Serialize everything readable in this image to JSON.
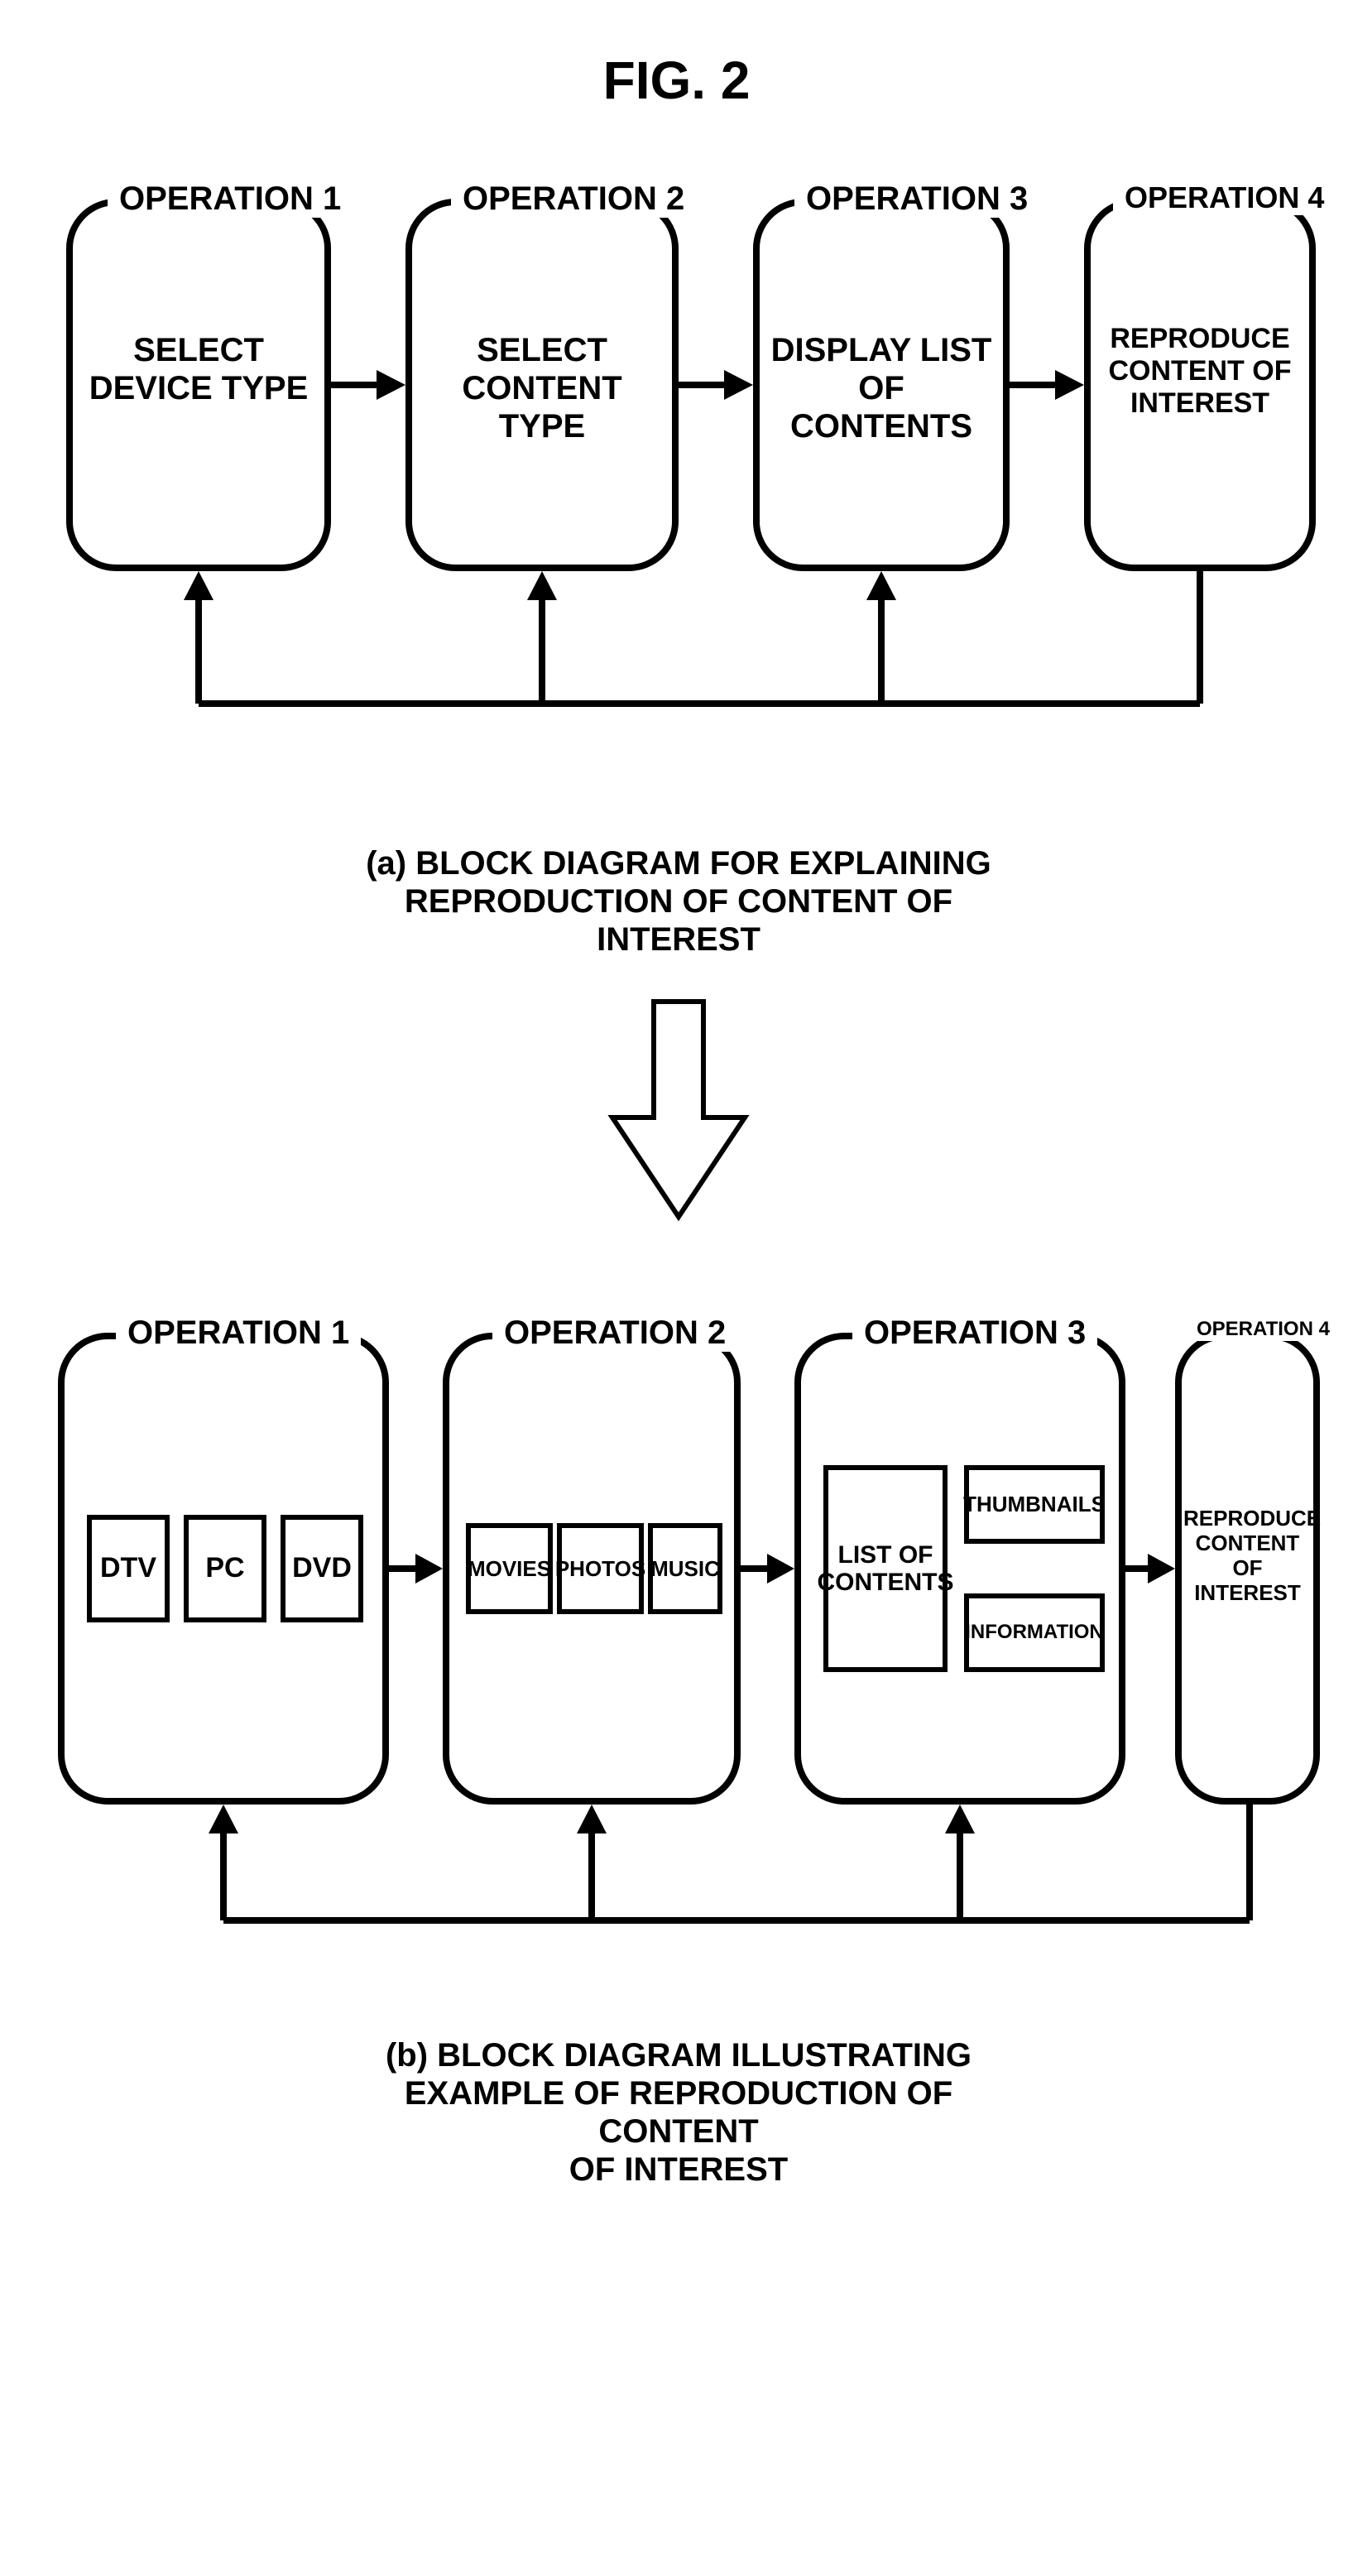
{
  "figTitle": "FIG. 2",
  "row1": {
    "op1": {
      "label": "OPERATION 1",
      "text": "SELECT DEVICE TYPE"
    },
    "op2": {
      "label": "OPERATION 2",
      "text": "SELECT CONTENT TYPE"
    },
    "op3": {
      "label": "OPERATION 3",
      "text": "DISPLAY LIST OF\nCONTENTS"
    },
    "op4": {
      "label": "OPERATION 4",
      "text": "REPRODUCE CONTENT OF\nINTEREST"
    }
  },
  "captionA": "(a) BLOCK DIAGRAM FOR EXPLAINING\nREPRODUCTION OF CONTENT OF INTEREST",
  "row2": {
    "op1": {
      "label": "OPERATION 1",
      "items": [
        "DTV",
        "PC",
        "DVD"
      ]
    },
    "op2": {
      "label": "OPERATION 2",
      "items": [
        "MOVIES",
        "PHOTOS",
        "MUSIC"
      ]
    },
    "op3": {
      "label": "OPERATION 3",
      "left": "LIST OF\nCONTENTS",
      "rightTop": "THUMBNAILS",
      "rightBottom": "INFORMATION"
    },
    "op4": {
      "label": "OPERATION 4",
      "text": "REPRODUCE\nCONTENT OF\nINTEREST"
    }
  },
  "captionB": "(b) BLOCK DIAGRAM ILLUSTRATING\nEXAMPLE OF REPRODUCTION OF CONTENT\nOF INTEREST"
}
